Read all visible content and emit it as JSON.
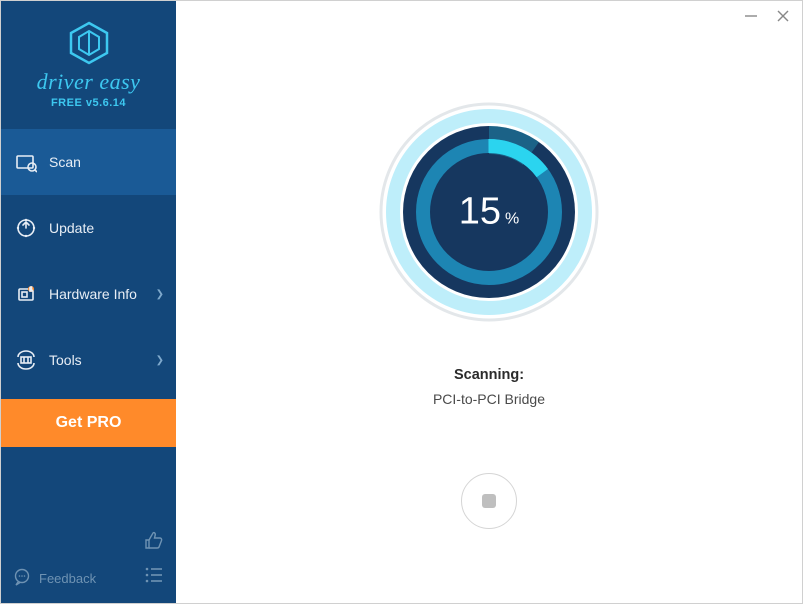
{
  "brand": {
    "name": "driver easy",
    "version": "FREE v5.6.14"
  },
  "sidebar": {
    "items": [
      {
        "label": "Scan",
        "icon": "scan-icon",
        "active": true,
        "hasSubmenu": false
      },
      {
        "label": "Update",
        "icon": "update-icon",
        "active": false,
        "hasSubmenu": false
      },
      {
        "label": "Hardware Info",
        "icon": "hardware-icon",
        "active": false,
        "hasSubmenu": true
      },
      {
        "label": "Tools",
        "icon": "tools-icon",
        "active": false,
        "hasSubmenu": true
      }
    ],
    "getPro": "Get PRO",
    "feedback": "Feedback"
  },
  "scan": {
    "progressPercent": 15,
    "percentUnit": "%",
    "statusTitle": "Scanning:",
    "statusItem": "PCI-to-PCI Bridge"
  },
  "colors": {
    "sidebarBg": "#13477a",
    "sidebarActive": "#1a5a96",
    "accentCyan": "#2bd4ef",
    "ringDark": "#16375f",
    "getPro": "#ff8a2a"
  }
}
